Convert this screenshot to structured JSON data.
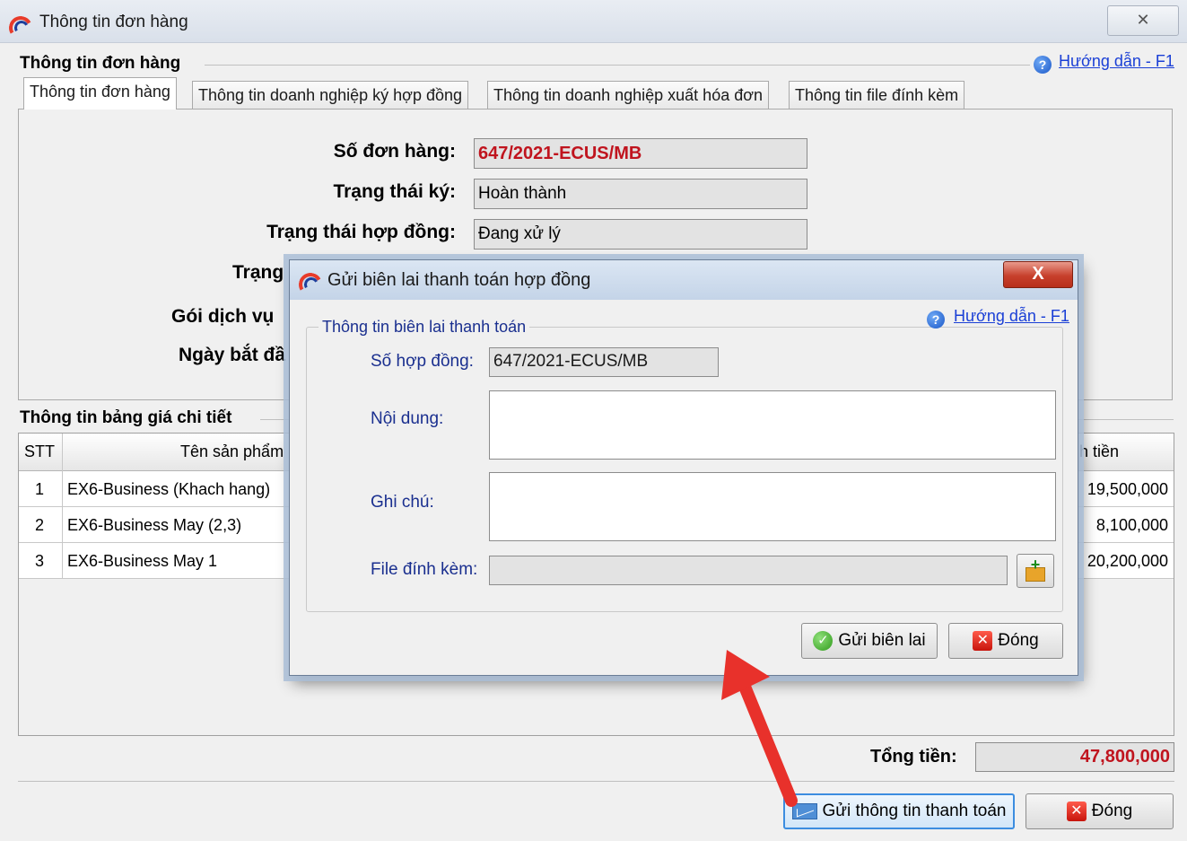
{
  "main_window": {
    "title": "Thông tin đơn hàng",
    "close_glyph": "✕",
    "group_title": "Thông tin đơn hàng",
    "help_link": "Hướng dẫn - F1",
    "tabs": [
      {
        "label": "Thông tin đơn hàng",
        "active": true
      },
      {
        "label": "Thông tin doanh nghiệp ký hợp đồng",
        "active": false
      },
      {
        "label": "Thông tin doanh nghiệp xuất hóa đơn",
        "active": false
      },
      {
        "label": "Thông tin file đính kèm",
        "active": false
      }
    ],
    "form": {
      "order_no_label": "Số đơn hàng:",
      "order_no_value": "647/2021-ECUS/MB",
      "sign_status_label": "Trạng thái ký:",
      "sign_status_value": "Hoàn thành",
      "contract_status_label": "Trạng thái hợp đồng:",
      "contract_status_value": "Đang xử lý",
      "partial_label_1": "Trạng",
      "partial_label_2": "Gói dịch vụ",
      "partial_label_3": "Ngày bắt đầ"
    },
    "price_group_title": "Thông tin bảng giá chi tiết",
    "grid": {
      "columns": [
        "STT",
        "Tên sản phẩm",
        "h tiền"
      ],
      "rows": [
        {
          "stt": "1",
          "name": "EX6-Business (Khach hang)",
          "amount": "19,500,000"
        },
        {
          "stt": "2",
          "name": "EX6-Business May (2,3)",
          "amount": "8,100,000"
        },
        {
          "stt": "3",
          "name": "EX6-Business May 1",
          "amount": "20,200,000"
        }
      ]
    },
    "total_label": "Tổng tiền:",
    "total_value": "47,800,000",
    "send_payment_button": "Gửi thông tin thanh toán",
    "close_button": "Đóng"
  },
  "dialog": {
    "title": "Gửi biên lai thanh toán hợp đồng",
    "close_glyph": "X",
    "group_title": "Thông tin biên lai thanh toán",
    "help_link": "Hướng dẫn - F1",
    "contract_no_label": "Số hợp đồng:",
    "contract_no_value": "647/2021-ECUS/MB",
    "content_label": "Nội dung:",
    "content_value": "",
    "note_label": "Ghi chú:",
    "note_value": "",
    "attachment_label": "File đính kèm:",
    "attachment_value": "",
    "send_button": "Gửi biên lai",
    "close_button": "Đóng"
  },
  "colors": {
    "highlight_red": "#c0141e",
    "link_blue": "#1a3fd6",
    "dialog_label_blue": "#1a2f8f",
    "arrow_red": "#e8312b"
  },
  "icons": [
    "app-logo-icon",
    "help-icon",
    "close-icon",
    "ok-check-icon",
    "mail-send-icon",
    "folder-add-icon"
  ]
}
